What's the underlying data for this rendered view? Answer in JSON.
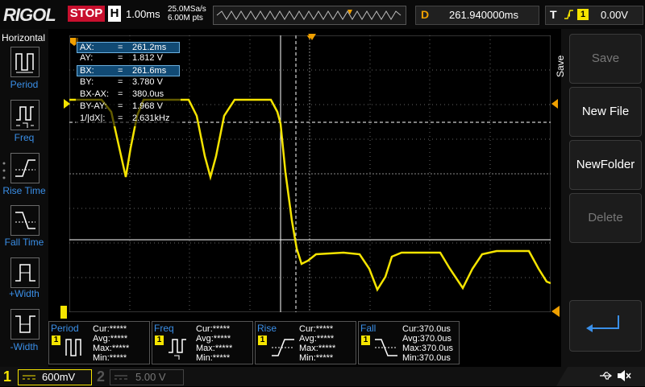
{
  "header": {
    "logo": "RIGOL",
    "run_state": "STOP",
    "timebase_label": "H",
    "timebase_value": "1.00ms",
    "sample_rate": "25.0MSa/s",
    "memory_depth": "6.00M pts",
    "delay_label": "D",
    "delay_value": "261.940000ms",
    "trigger_label": "T",
    "trigger_channel": "1",
    "trigger_level": "0.00V"
  },
  "left_panel": {
    "title": "Horizontal",
    "items": [
      {
        "label": "Period",
        "icon": "period-icon"
      },
      {
        "label": "Freq",
        "icon": "freq-icon"
      },
      {
        "label": "Rise Time",
        "icon": "rise-time-icon"
      },
      {
        "label": "Fall Time",
        "icon": "fall-time-icon"
      },
      {
        "label": "+Width",
        "icon": "pos-width-icon"
      },
      {
        "label": "-Width",
        "icon": "neg-width-icon"
      }
    ]
  },
  "cursor_info": [
    {
      "key": "AX:",
      "eq": "=",
      "value": "261.2ms",
      "highlight": true
    },
    {
      "key": "AY:",
      "eq": "=",
      "value": "1.812 V",
      "highlight": false
    },
    {
      "key": "BX:",
      "eq": "=",
      "value": "261.6ms",
      "highlight": true
    },
    {
      "key": "BY:",
      "eq": "=",
      "value": "3.780 V",
      "highlight": false
    },
    {
      "key": "BX-AX:",
      "eq": "=",
      "value": "380.0us",
      "highlight": false
    },
    {
      "key": "BY-AY:",
      "eq": "=",
      "value": "1.968 V",
      "highlight": false
    },
    {
      "key": "1/|dX|:",
      "eq": "=",
      "value": "2.631kHz",
      "highlight": false
    }
  ],
  "right_panel": {
    "tab": "Save",
    "buttons": [
      {
        "label": "Save",
        "enabled": false
      },
      {
        "label": "New File",
        "enabled": true
      },
      {
        "label": "NewFolder",
        "enabled": true
      },
      {
        "label": "Delete",
        "enabled": false
      }
    ],
    "enter_icon": "enter-arrow-icon"
  },
  "measurements": [
    {
      "title": "Period",
      "channel": "1",
      "cur": "Cur:*****",
      "avg": "Avg:*****",
      "max": "Max:*****",
      "min": "Min:*****"
    },
    {
      "title": "Freq",
      "channel": "1",
      "cur": "Cur:*****",
      "avg": "Avg:*****",
      "max": "Max:*****",
      "min": "Min:*****"
    },
    {
      "title": "Rise",
      "channel": "1",
      "cur": "Cur:*****",
      "avg": "Avg:*****",
      "max": "Max:*****",
      "min": "Min:*****"
    },
    {
      "title": "Fall",
      "channel": "1",
      "cur": "Cur:370.0us",
      "avg": "Avg:370.0us",
      "max": "Max:370.0us",
      "min": "Min:370.0us"
    }
  ],
  "bottom": {
    "ch1_number": "1",
    "ch1_scale": "600mV",
    "ch2_number": "2",
    "ch2_scale": "5.00 V"
  },
  "colors": {
    "trace": "#f5e400",
    "accent_blue": "#3a8fe8",
    "stop_red": "#c8102e",
    "marker_orange": "#f0a000"
  }
}
